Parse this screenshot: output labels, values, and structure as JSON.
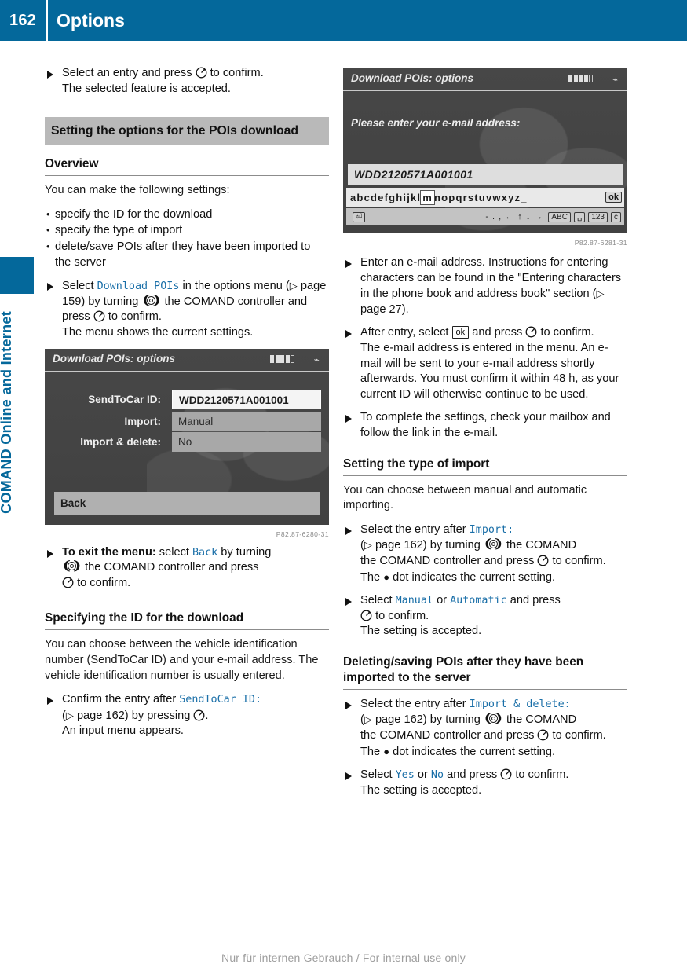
{
  "header": {
    "page_number": "162",
    "title": "Options"
  },
  "sidebar": {
    "chapter_label": "COMAND Online and Internet"
  },
  "footer": {
    "note": "Nur für internen Gebrauch / For internal use only"
  },
  "left_column": {
    "step_confirm": {
      "text_before": "Select an entry and press",
      "icon": "press-controller-icon",
      "text_after": "to confirm.",
      "result": "The selected feature is accepted."
    },
    "section_heading": "Setting the options for the POIs download",
    "overview_heading": "Overview",
    "overview_intro": "You can make the following settings:",
    "overview_bullets": [
      "specify the ID for the download",
      "specify the type of import",
      "delete/save POIs after they have been imported to the server"
    ],
    "step_download_pois": {
      "p1": "Select",
      "menu_item": "Download POIs",
      "p2": "in the options menu",
      "p3": "page 159) by turning",
      "p4": "the COMAND controller and press",
      "p5": "to confirm.",
      "result": "The menu shows the current settings."
    },
    "screenshot_options": {
      "title": "Download POIs: options",
      "rows": [
        {
          "label": "SendToCar ID:",
          "value": "WDD2120571A001001",
          "selected": true
        },
        {
          "label": "Import:",
          "value": "Manual",
          "selected": false
        },
        {
          "label": "Import & delete:",
          "value": "No",
          "selected": false
        }
      ],
      "back_label": "Back",
      "caption": "P82.87-6280-31"
    },
    "step_exit_menu": {
      "bold": "To exit the menu:",
      "p1": "select",
      "menu_item": "Back",
      "p2": "by turning",
      "p3": "the COMAND controller and press",
      "p4": "to confirm."
    },
    "id_heading": "Specifying the ID for the download",
    "id_body": "You can choose between the vehicle identification number (SendToCar ID) and your e-mail address. The vehicle identification number is usually entered.",
    "step_confirm_entry": {
      "p1": "Confirm the entry after",
      "menu_item": "SendToCar ID:",
      "p2": "page 162) by pressing",
      "p3": ".",
      "result": "An input menu appears."
    }
  },
  "right_column": {
    "screenshot_email": {
      "title": "Download POIs: options",
      "prompt": "Please enter your e-mail address:",
      "entry_value": "WDD2120571A001001",
      "keyboard_row1": "abcdefghijkl",
      "keyboard_highlight": "m",
      "keyboard_row1b": "nopqrstuvwxyz_",
      "keyboard_ok": "ok",
      "keyboard_row2_symbols": "- . ,",
      "keyboard_row2_keys": [
        "ABC",
        "␣",
        "123",
        "c"
      ],
      "caption": "P82.87-6281-31"
    },
    "step_enter_email": {
      "text": "Enter an e-mail address. Instructions for entering characters can be found in the \"Entering characters in the phone book and address book\" section (",
      "page_ref": "page 27)."
    },
    "step_after_entry": {
      "p1": "After entry, select",
      "ok_key": "ok",
      "p2": "and press",
      "p3": "to confirm.",
      "result": "The e-mail address is entered in the menu. An e-mail will be sent to your e-mail address shortly afterwards. You must confirm it within 48 h, as your current ID will otherwise continue to be used."
    },
    "step_complete": "To complete the settings, check your mailbox and follow the link in the e-mail.",
    "import_heading": "Setting the type of import",
    "import_body": "You can choose between manual and automatic importing.",
    "step_select_import": {
      "p1": "Select the entry after",
      "menu_item": "Import:",
      "p2": "page 162) by turning",
      "p3": "the COMAND controller and press",
      "p4": "to confirm.",
      "result_pre": "The",
      "result_post": "dot indicates the current setting."
    },
    "step_manual_auto": {
      "p1": "Select",
      "option_a": "Manual",
      "p2": "or",
      "option_b": "Automatic",
      "p3": "and press",
      "p4": "to confirm.",
      "result": "The setting is accepted."
    },
    "delete_heading": "Deleting/saving POIs after they have been imported to the server",
    "step_select_delete": {
      "p1": "Select the entry after",
      "menu_item": "Import & delete:",
      "p2": "page 162) by turning",
      "p3": "the COMAND controller and press",
      "p4": "to confirm.",
      "result_pre": "The",
      "result_post": "dot indicates the current setting."
    },
    "step_yes_no": {
      "p1": "Select",
      "option_a": "Yes",
      "p2": "or",
      "option_b": "No",
      "p3": "and press",
      "p4": "to confirm.",
      "result": "The setting is accepted."
    }
  }
}
